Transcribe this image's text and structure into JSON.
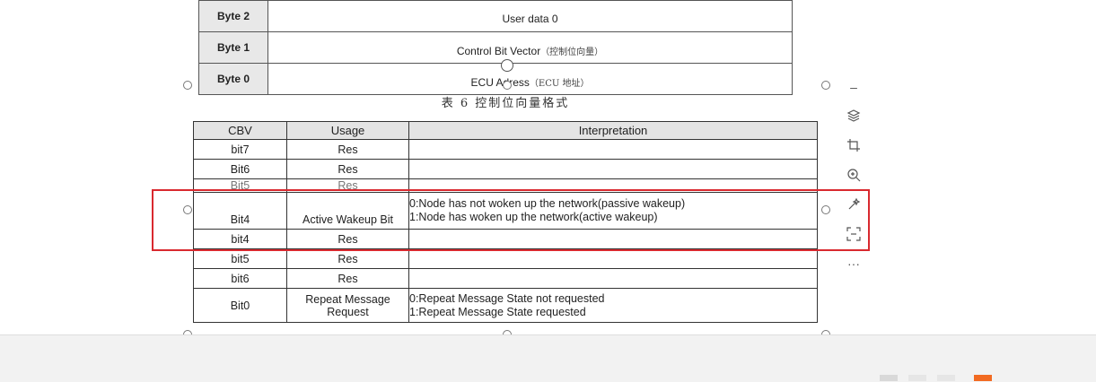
{
  "top_table": [
    {
      "label": "Byte 2",
      "value": "User data 0",
      "value_cn": ""
    },
    {
      "label": "Byte 1",
      "value": "Control Bit Vector",
      "value_cn": "（控制位向量）"
    },
    {
      "label": "Byte 0",
      "value": "ECU Adress",
      "value_cn": "（ECU 地址）"
    }
  ],
  "caption": "表 6 控制位向量格式",
  "cbv_table": {
    "headers": [
      "CBV",
      "Usage",
      "Interpretation"
    ],
    "rows": [
      {
        "cbv": "bit7",
        "usage": "Res",
        "interp1": "",
        "interp2": ""
      },
      {
        "cbv": "Bit6",
        "usage": "Res",
        "interp1": "",
        "interp2": ""
      },
      {
        "cbv": "Bit5",
        "usage": "Res",
        "interp1": "",
        "interp2": ""
      },
      {
        "cbv": "Bit4",
        "usage": "Active Wakeup Bit",
        "interp1": "0:Node has not woken up the network(passive wakeup)",
        "interp2": "1:Node has woken up the network(active wakeup)"
      },
      {
        "cbv": "bit4",
        "usage": "Res",
        "interp1": "",
        "interp2": ""
      },
      {
        "cbv": "bit5",
        "usage": "Res",
        "interp1": "",
        "interp2": ""
      },
      {
        "cbv": "bit6",
        "usage": "Res",
        "interp1": "",
        "interp2": ""
      },
      {
        "cbv": "Bit0",
        "usage": "Repeat Message Request",
        "interp1": "0:Repeat Message State not requested",
        "interp2": "1:Repeat Message State requested"
      }
    ]
  },
  "toolbar": {
    "icons": [
      "minus-icon",
      "layers-icon",
      "crop-icon",
      "zoom-in-icon",
      "ai-tools-icon",
      "ocr-scan-icon",
      "more-icon"
    ],
    "more_label": "···",
    "minus_label": "–"
  },
  "colors": {
    "highlight": "#d9292f",
    "status_accent": "#f26b22"
  }
}
